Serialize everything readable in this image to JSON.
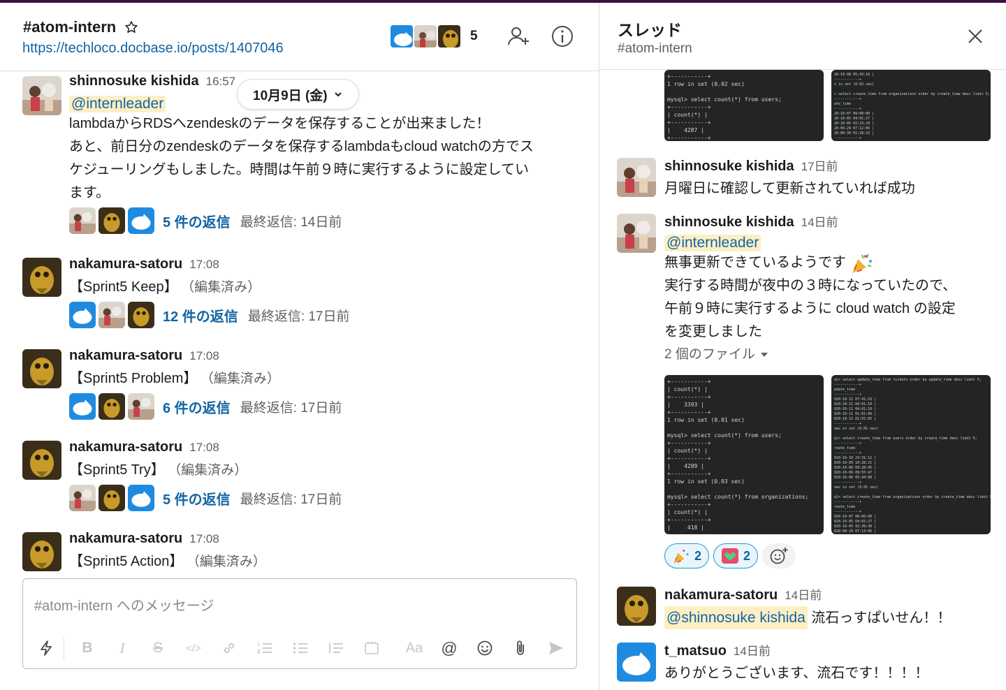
{
  "channel": {
    "name": "#atom-intern",
    "topic": "https://techloco.docbase.io/posts/1407046",
    "member_count": "5"
  },
  "date_divider": {
    "label": "10月9日 (金)"
  },
  "messages": [
    {
      "user": "shinnosuke kishida",
      "time": "16:57",
      "mention": "@internleader",
      "lines": [
        "lambdaからRDSへzendeskのデータを保存することが出来ました！",
        "あと、前日分のzendeskのデータを保存するlambdaもcloud watchの方でス",
        "ケジューリングもしました。時間は午前９時に実行するように設定してい",
        "ます。"
      ],
      "reply_count": "5 件の返信",
      "last_reply": "最終返信: 14日前"
    },
    {
      "user": "nakamura-satoru",
      "time": "17:08",
      "text": "【Sprint5 Keep】",
      "edited": "（編集済み）",
      "reply_count": "12 件の返信",
      "last_reply": "最終返信: 17日前"
    },
    {
      "user": "nakamura-satoru",
      "time": "17:08",
      "text": "【Sprint5 Problem】",
      "edited": "（編集済み）",
      "reply_count": "6 件の返信",
      "last_reply": "最終返信: 17日前"
    },
    {
      "user": "nakamura-satoru",
      "time": "17:08",
      "text": "【Sprint5 Try】",
      "edited": "（編集済み）",
      "reply_count": "5 件の返信",
      "last_reply": "最終返信: 17日前"
    },
    {
      "user": "nakamura-satoru",
      "time": "17:08",
      "text": "【Sprint5 Action】",
      "edited": "（編集済み）"
    }
  ],
  "composer": {
    "placeholder": "#atom-intern へのメッセージ",
    "format_label": "Aa"
  },
  "thread": {
    "title": "スレッド",
    "channel": "#atom-intern",
    "top_shot_left": "+-----------+\n1 row in set (0.02 sec)\n\nmysql> select count(*) from users;\n+-----------+\n| count(*) |\n+-----------+\n|    4287 |\n+-----------+",
    "top_shot_right": "20-10-08 05:43:16 |\n------------+\ns in set (0.02 sec)\n\n> select create_time from organizations order by create_time desc limit 5;\n------------+\nate_time\n------------+\n20-10-07 09:00:00 |\n20-10-05 04:01:27 |\n20-10-05 02:23:29 |\n20-09-29 07:12:06 |\n20-09-30 01:28:32 |\n------------+\ns in set (0.02 sec)",
    "messages": [
      {
        "user": "shinnosuke kishida",
        "time": "17日前",
        "text": "月曜日に確認して更新されていれば成功"
      },
      {
        "user": "shinnosuke kishida",
        "time": "14日前",
        "mention": "@internleader",
        "lines": [
          "無事更新できているようです",
          "実行する時間が夜中の３時になっていたので、",
          "午前９時に実行するように cloud watch の設定",
          "を変更しました"
        ],
        "files_label": "2 個のファイル",
        "shot_left": "+-----------+\n| count(*) |\n+-----------+\n|    3393 |\n+-----------+\n1 row in set (0.01 sec)\n\nmysql> select count(*) from users;\n+-----------+\n| count(*) |\n+-----------+\n|    4289 |\n+-----------+\n1 row in set (0.03 sec)\n\nmysql> select count(*) from organizations;\n+-----------+\n| count(*) |\n+-----------+\n|     418 |\n+-----------+\n1 row in set (0.02 sec)\n\nmysql> ",
        "shot_right": "ql> select update_time from tickets order by update_time desc limit 5;\n------------+\npdate_time\n------------+\n020-10-11 07:41:23 |\n020-10-11 04:01:10 |\n020-10-11 04:01:10 |\n020-10-11 01:01:06 |\n020-10-11 01:01:05 |\n------------+\nows in set (0.01 sec)\n\nql> select create_time from users order by create_time desc limit 5;\n------------+\nreate_time\n------------+\n020-10-10 23:31:12 |\n020-10-05 10:28:21 |\n020-10-06 09:28:45 |\n020-10-06 09:55:47 |\n020-10-06 05:44:08 |\n------------+\nows in set (0.01 sec)\n\nql> select create_time from organizations order by create_time desc limit 5;\n------------+\nreate_time\n------------+\n020-10-07 06:00:00 |\n020-10-05 04:01:27 |\n020-10-05 02:39:39 |\n020-09-29 07:13:06 |\n020-09-30 01:28:32 |\n------------+\nows in set (0.02 sec)",
        "reactions": [
          {
            "emoji": "party-popper",
            "count": "2"
          },
          {
            "emoji": "heart-face",
            "count": "2"
          }
        ]
      },
      {
        "user": "nakamura-satoru",
        "time": "14日前",
        "mention": "@shinnosuke kishida",
        "text": "流石っすぱいせん！！"
      },
      {
        "user": "t_matsuo",
        "time": "14日前",
        "text": "ありがとうございます、流石です！！！！"
      }
    ]
  },
  "colors": {
    "link": "#1264a3",
    "mention_bg": "#fcefc4",
    "reaction_border": "#1d9bd1",
    "aubergine": "#3f0e40"
  }
}
